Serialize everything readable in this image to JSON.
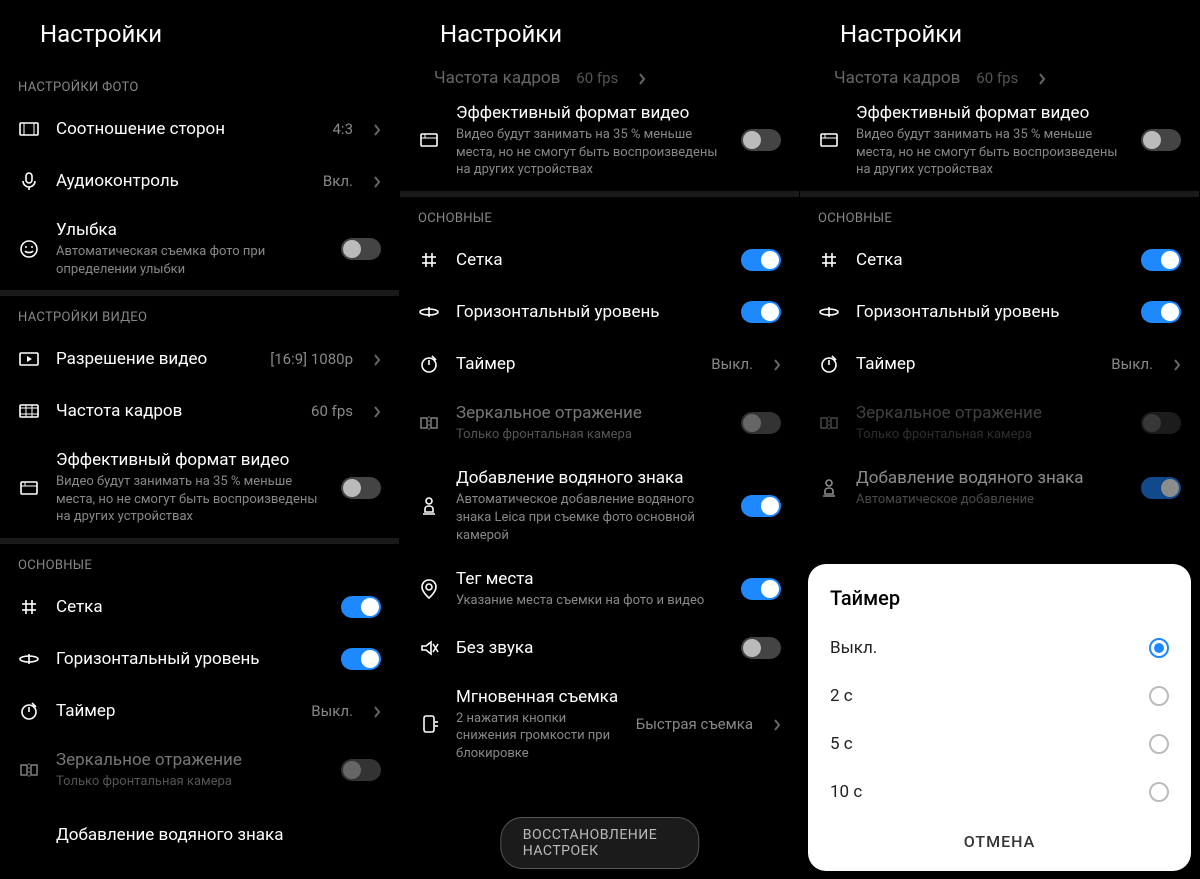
{
  "header": {
    "title": "Настройки"
  },
  "sections": {
    "photo": "НАСТРОЙКИ ФОТО",
    "video": "НАСТРОЙКИ ВИДЕО",
    "general": "ОСНОВНЫЕ"
  },
  "rows": {
    "aspect": {
      "label": "Соотношение сторон",
      "value": "4:3"
    },
    "audio": {
      "label": "Аудиоконтроль",
      "value": "Вкл."
    },
    "smile": {
      "label": "Улыбка",
      "sub": "Автоматическая съемка фото при определении улыбки"
    },
    "vres": {
      "label": "Разрешение видео",
      "value": "[16:9] 1080p"
    },
    "fps": {
      "label": "Частота кадров",
      "value": "60 fps"
    },
    "fps_cut": {
      "label": "Частота кадров",
      "value": "60 fps"
    },
    "eff": {
      "label": "Эффективный формат видео",
      "sub": "Видео будут занимать на 35 % меньше места, но не смогут быть воспроизведены на других устройствах"
    },
    "grid": {
      "label": "Сетка"
    },
    "level": {
      "label": "Горизонтальный уровень"
    },
    "timer": {
      "label": "Таймер",
      "value": "Выкл."
    },
    "mirror": {
      "label": "Зеркальное отражение",
      "sub": "Только фронтальная камера"
    },
    "wmark": {
      "label": "Добавление водяного знака",
      "sub": "Автоматическое добавление водяного знака Leica при съемке фото основной камерой"
    },
    "wmark_short": {
      "label": "Добавление водяного знака",
      "sub": "Автоматическое добавление"
    },
    "geo": {
      "label": "Тег места",
      "sub": "Указание места съемки на фото и видео"
    },
    "mute": {
      "label": "Без звука"
    },
    "quick": {
      "label": "Мгновенная съемка",
      "sub": "2 нажатия кнопки снижения громкости при блокировке",
      "value": "Быстрая съемка"
    }
  },
  "reset": "ВОССТАНОВЛЕНИЕ НАСТРОЕК",
  "sheet": {
    "title": "Таймер",
    "options": {
      "0": "Выкл.",
      "1": "2 с",
      "2": "5 с",
      "3": "10 с"
    },
    "cancel": "ОТМЕНА"
  }
}
